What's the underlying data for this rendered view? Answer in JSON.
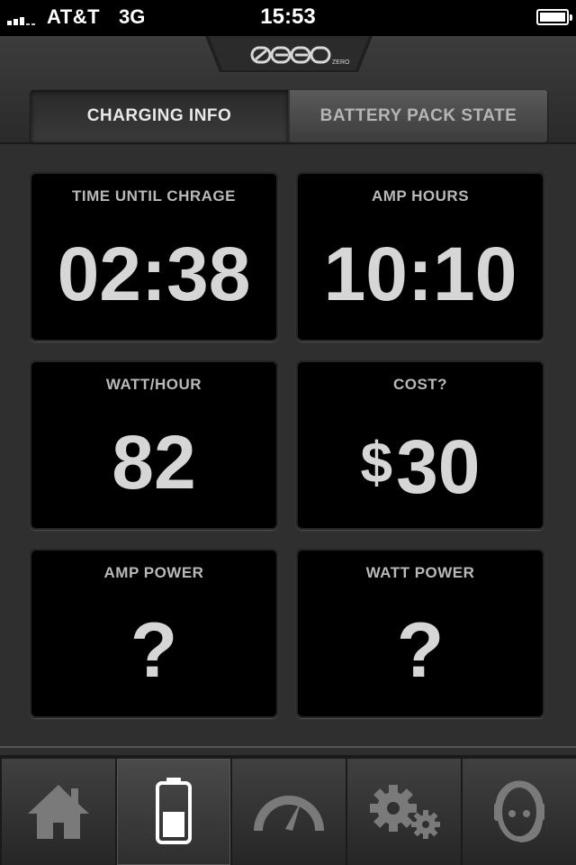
{
  "status_bar": {
    "carrier": "AT&T",
    "network": "3G",
    "time": "15:53"
  },
  "header": {
    "logo_text": "ZERO"
  },
  "segmented": {
    "tabs": [
      {
        "label": "CHARGING INFO",
        "active": true
      },
      {
        "label": "BATTERY PACK STATE",
        "active": false
      }
    ]
  },
  "tiles": [
    {
      "label": "TIME UNTIL CHRAGE",
      "value": "02:38"
    },
    {
      "label": "AMP HOURS",
      "value": "10:10"
    },
    {
      "label": "WATT/HOUR",
      "value": "82"
    },
    {
      "label": "COST?",
      "currency": "$",
      "value": "30"
    },
    {
      "label": "AMP POWER",
      "value": "?"
    },
    {
      "label": "WATT POWER",
      "value": "?"
    }
  ],
  "tab_bar": {
    "items": [
      {
        "icon": "home-icon"
      },
      {
        "icon": "battery-icon",
        "selected": true
      },
      {
        "icon": "speedometer-icon"
      },
      {
        "icon": "gears-icon"
      },
      {
        "icon": "support-headset-icon"
      }
    ]
  },
  "colors": {
    "background": "#2f2f2f",
    "tile_background": "#000000",
    "tile_value": "#d6d6d6",
    "tile_label": "#b9b9b9",
    "icon_gray": "#7a7a7a"
  }
}
